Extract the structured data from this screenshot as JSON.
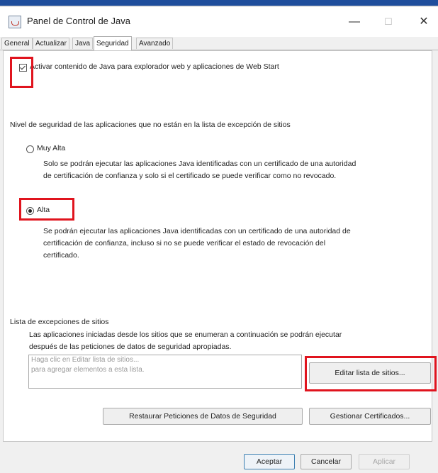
{
  "window": {
    "title": "Panel de Control de Java",
    "minimize": "—",
    "maximize": "☐",
    "close": "✕"
  },
  "tabs": [
    "General",
    "Actualizar",
    "Java",
    "Seguridad",
    "Avanzado"
  ],
  "active_tab": "Seguridad",
  "enable_checkbox": {
    "label": "Activar contenido de Java para explorador web y aplicaciones de Web Start",
    "checked": true
  },
  "security": {
    "heading": "Nivel de seguridad de las aplicaciones que no están en la lista de excepción de sitios",
    "options": [
      {
        "label": "Muy Alta",
        "description_lines": [
          "Solo se podrán ejecutar las aplicaciones Java identificadas con un certificado de una autoridad",
          "de certificación de confianza y solo si el certificado se puede verificar como no revocado."
        ],
        "selected": false
      },
      {
        "label": "Alta",
        "description_lines": [
          "Se podrán ejecutar las aplicaciones Java identificadas con un certificado de una autoridad de",
          "certificación de confianza, incluso si no se puede verificar el estado de revocación del",
          "certificado."
        ],
        "selected": true
      }
    ]
  },
  "exceptions": {
    "heading": "Lista de excepciones de sitios",
    "description_lines": [
      "Las aplicaciones iniciadas desde los sitios que se enumeran a continuación se podrán ejecutar",
      "después de las peticiones de datos de seguridad apropiadas."
    ],
    "placeholder_lines": [
      "Haga clic en Editar lista de sitios...",
      "para agregar elementos a esta lista."
    ],
    "edit_button": "Editar lista de sitios..."
  },
  "buttons": {
    "restore": "Restaurar Peticiones de Datos de Seguridad",
    "certificates": "Gestionar Certificados...",
    "accept": "Aceptar",
    "cancel": "Cancelar",
    "apply": "Aplicar"
  },
  "colors": {
    "highlight": "#e0141e",
    "title_bar": "#ffffff",
    "panel": "#ffffff",
    "background": "#f0f0f0"
  }
}
